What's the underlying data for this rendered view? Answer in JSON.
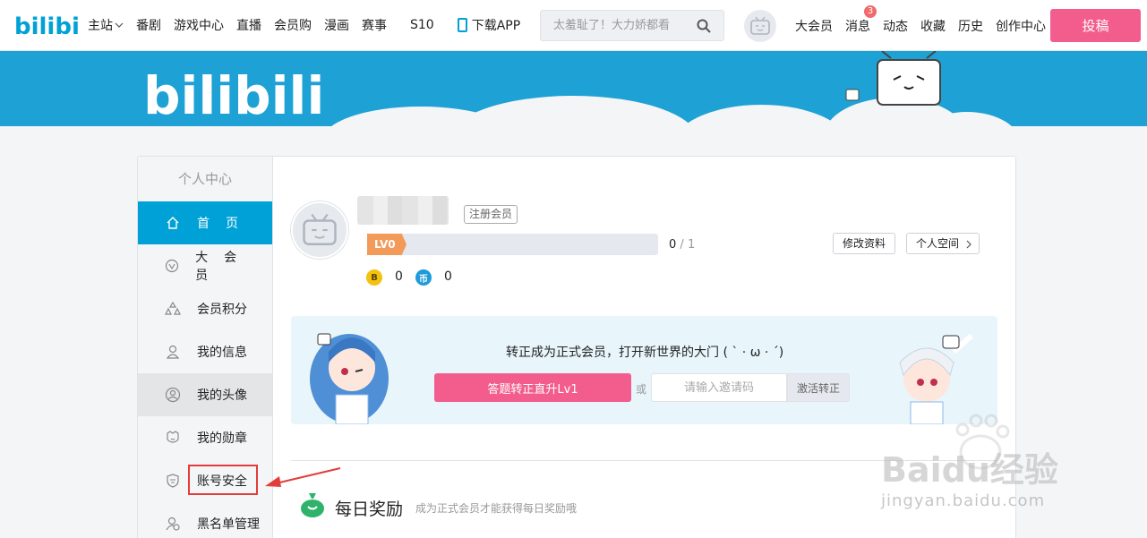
{
  "topnav": {
    "logo_text": "bilibili",
    "items": [
      {
        "label": "主站"
      },
      {
        "label": "番剧"
      },
      {
        "label": "游戏中心"
      },
      {
        "label": "直播"
      },
      {
        "label": "会员购"
      },
      {
        "label": "漫画"
      },
      {
        "label": "赛事"
      }
    ],
    "s10": "S10",
    "download_app": "下载APP",
    "search_placeholder": "太羞耻了！大力娇都看",
    "right_items": [
      {
        "label": "大会员"
      },
      {
        "label": "消息",
        "badge": "3"
      },
      {
        "label": "动态"
      },
      {
        "label": "收藏"
      },
      {
        "label": "历史"
      },
      {
        "label": "创作中心"
      }
    ],
    "upload_label": "投稿"
  },
  "banner": {
    "logo_text": "bilibili"
  },
  "sidebar": {
    "title": "个人中心",
    "items": [
      {
        "label": "首页",
        "icon": "home-icon",
        "state": "active"
      },
      {
        "label": "大会员",
        "icon": "vip-icon"
      },
      {
        "label": "会员积分",
        "icon": "points-icon"
      },
      {
        "label": "我的信息",
        "icon": "user-info-icon"
      },
      {
        "label": "我的头像",
        "icon": "avatar-icon",
        "state": "hover"
      },
      {
        "label": "我的勋章",
        "icon": "medal-icon"
      },
      {
        "label": "账号安全",
        "icon": "shield-icon",
        "highlighted": true
      },
      {
        "label": "黑名单管理",
        "icon": "blacklist-icon"
      }
    ]
  },
  "profile": {
    "member_tag": "注册会员",
    "level": "LV0",
    "exp_current": "0",
    "exp_sep": "/",
    "exp_max": "1",
    "edit_button": "修改资料",
    "space_button": "个人空间",
    "bcoin_symbol": "B",
    "bcoin_value": "0",
    "coin_symbol": "币",
    "coin_value": "0"
  },
  "upgrade": {
    "text": "转正成为正式会员，打开新世界的大门 ( ` · ω · ´)",
    "answer_button": "答题转正直升Lv1",
    "or": "或",
    "invite_placeholder": "请输入邀请码",
    "activate_button": "激活转正"
  },
  "daily": {
    "title": "每日奖励",
    "subtitle": "成为正式会员才能获得每日奖励哦"
  },
  "watermark": {
    "brand": "Baidu经验",
    "url": "jingyan.baidu.com"
  },
  "colors": {
    "primary": "#00a1d6",
    "pink": "#f25d8e",
    "level_orange": "#f19a5a",
    "highlight_red": "#e33c3c"
  }
}
